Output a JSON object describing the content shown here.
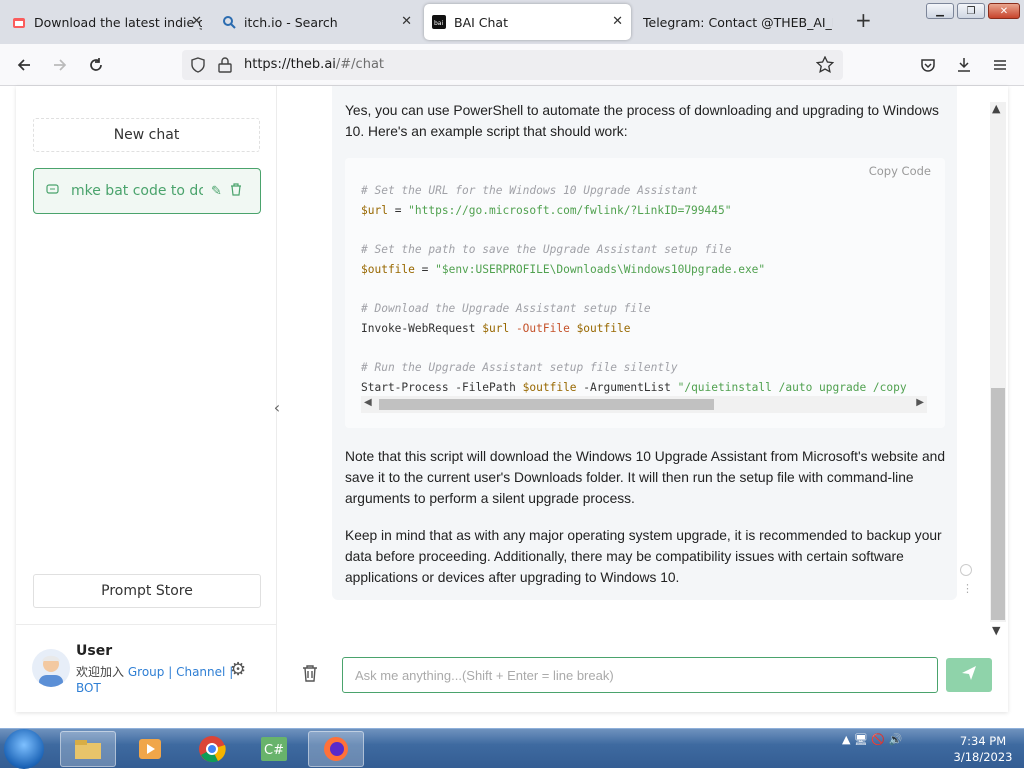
{
  "browser": {
    "tabs": [
      {
        "title": "Download the latest indie games",
        "active": false
      },
      {
        "title": "itch.io - Search",
        "active": false
      },
      {
        "title": "BAI Chat",
        "active": true
      },
      {
        "title": "Telegram: Contact @THEB_AI_BOT",
        "active": false
      }
    ],
    "new_tab": "+",
    "url_host": "https://theb.ai",
    "url_path": "/#/chat"
  },
  "sidebar": {
    "new_chat_label": "New chat",
    "chat_items": [
      {
        "label": "mke bat code to download..."
      }
    ],
    "prompt_store_label": "Prompt Store",
    "user": {
      "name": "User",
      "join_text": "欢迎加入",
      "group": "Group",
      "channel": "Channel",
      "bot": "BOT",
      "sep": "|"
    }
  },
  "message": {
    "intro": "Yes, you can use PowerShell to automate the process of downloading and upgrading to Windows 10. Here's an example script that should work:",
    "copy_code": "Copy  Code",
    "code": {
      "c1": "# Set the URL for the Windows 10 Upgrade Assistant",
      "l1_var": "$url",
      "l1_eq": " = ",
      "l1_str": "\"https://go.microsoft.com/fwlink/?LinkID=799445\"",
      "c2": "# Set the path to save the Upgrade Assistant setup file",
      "l2_var": "$outfile",
      "l2_eq": " = ",
      "l2_str": "\"$env:USERPROFILE\\Downloads\\Windows10Upgrade.exe\"",
      "c3": "# Download the Upgrade Assistant setup file",
      "l3_cmd": "Invoke-WebRequest ",
      "l3_v1": "$url",
      "l3_p": " -OutFile ",
      "l3_v2": "$outfile",
      "c4": "# Run the Upgrade Assistant setup file silently",
      "l4_cmd": "Start-Process -FilePath ",
      "l4_v1": "$outfile",
      "l4_p": " -ArgumentList ",
      "l4_str": "\"/quietinstall /auto upgrade /copy"
    },
    "note": "Note that this script will download the Windows 10 Upgrade Assistant from Microsoft's website and save it to the current user's Downloads folder. It will then run the setup file with command-line arguments to perform a silent upgrade process.",
    "keep": "Keep in mind that as with any major operating system upgrade, it is recommended to backup your data before proceeding. Additionally, there may be compatibility issues with certain software applications or devices after upgrading to Windows 10."
  },
  "input": {
    "placeholder": "Ask me anything...(Shift + Enter = line break)"
  },
  "taskbar": {
    "time": "7:34 PM",
    "date": "3/18/2023"
  },
  "colors": {
    "accent": "#4aa36c",
    "send_button": "#8fd3aa"
  }
}
